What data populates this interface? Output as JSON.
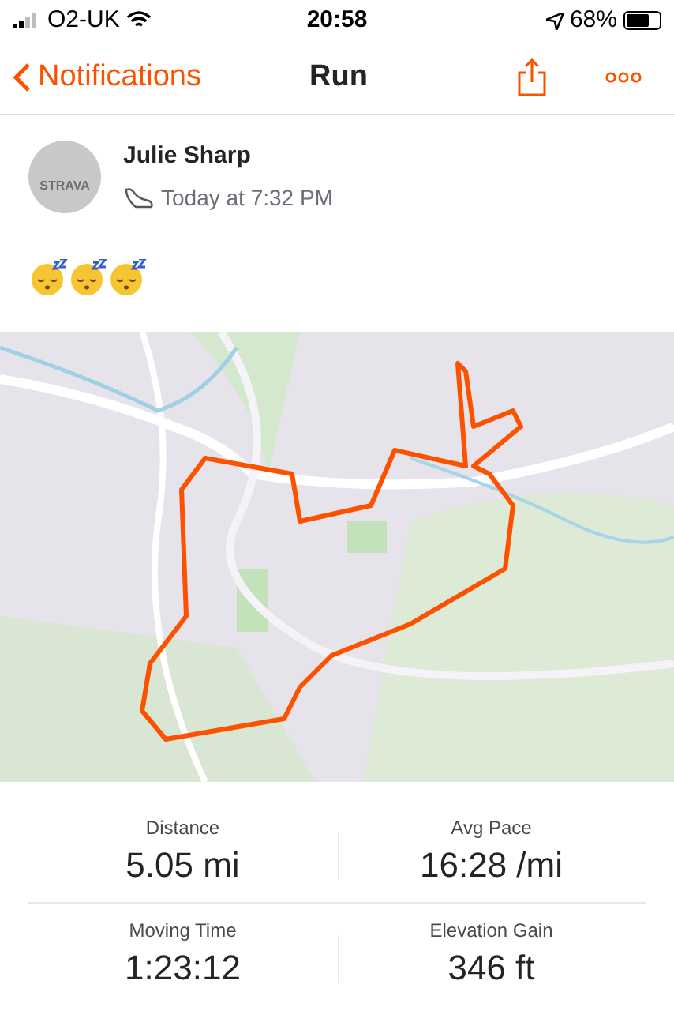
{
  "status_bar": {
    "carrier": "O2-UK",
    "time": "20:58",
    "battery": "68%"
  },
  "nav": {
    "back_label": "Notifications",
    "title": "Run"
  },
  "athlete": {
    "avatar_label": "STRAVA",
    "name": "Julie Sharp",
    "time": "Today at 7:32 PM"
  },
  "reactions": [
    {
      "kind": "sleeping"
    },
    {
      "kind": "sleeping"
    },
    {
      "kind": "sleeping"
    }
  ],
  "stats": [
    {
      "label": "Distance",
      "value": "5.05 mi"
    },
    {
      "label": "Avg Pace",
      "value": "16:28 /mi"
    },
    {
      "label": "Moving Time",
      "value": "1:23:12"
    },
    {
      "label": "Elevation Gain",
      "value": "346 ft"
    }
  ]
}
